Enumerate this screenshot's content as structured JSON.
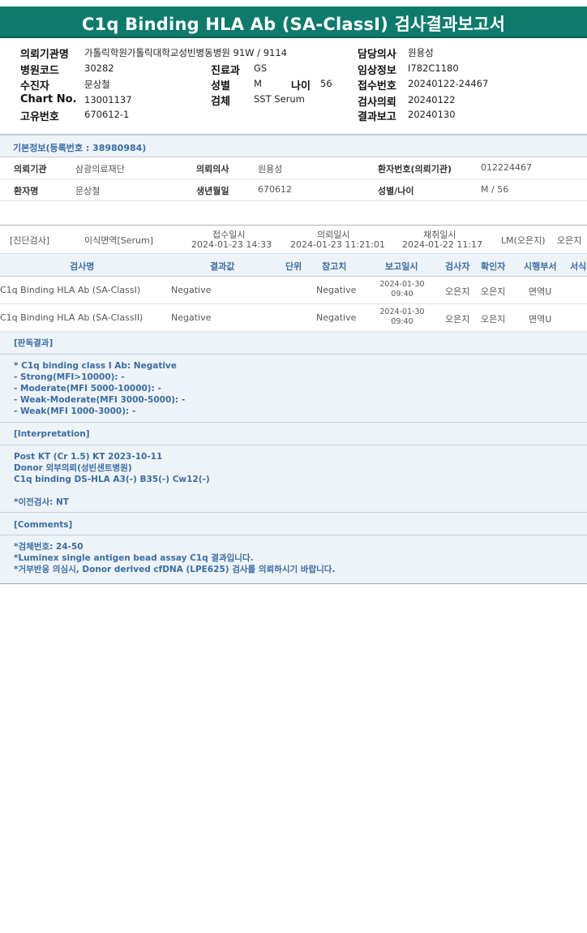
{
  "title": "C1q Binding HLA Ab (SA-ClassI) 검사결과보고서",
  "header": {
    "left": [
      {
        "label": "의뢰기관명",
        "value": "가톨릭학원가톨릭대학교성빈병동병원 91W / 9114"
      },
      {
        "label": "병원코드",
        "value": "30282"
      },
      {
        "label": "수진자",
        "value": "문상철"
      },
      {
        "label": "Chart No.",
        "value": "13001137"
      },
      {
        "label": "고유번호",
        "value": "670612-1"
      }
    ],
    "mid": [
      {
        "label": "진료과",
        "value": "GS"
      },
      {
        "label": "성별",
        "value": "M"
      },
      {
        "label": "검체",
        "value": "SST Serum"
      }
    ],
    "age": {
      "label": "나이",
      "value": "56"
    },
    "right": [
      {
        "label": "담당의사",
        "value": "원용성"
      },
      {
        "label": "임상정보",
        "value": "I782C1180"
      },
      {
        "label": "접수번호",
        "value": "20240122-24467"
      },
      {
        "label": "검사의뢰",
        "value": "20240122"
      },
      {
        "label": "결과보고",
        "value": "20240130"
      }
    ]
  },
  "basic": {
    "title": "기본정보(등록번호 : 38980984)",
    "rows": [
      [
        {
          "label": "의뢰기관",
          "value": "삼광의료재단"
        },
        {
          "label": "의뢰의사",
          "value": "원용성"
        },
        {
          "label": "환자번호(의뢰기관)",
          "value": "012224467"
        }
      ],
      [
        {
          "label": "환자명",
          "value": "문상철"
        },
        {
          "label": "생년월일",
          "value": "670612"
        },
        {
          "label": "성별/나이",
          "value": "M / 56"
        }
      ]
    ]
  },
  "specimen": {
    "category": "[진단검사]",
    "type": "이식면역[Serum]",
    "received_label": "접수일시",
    "received": "2024-01-23 14:33",
    "requested_label": "의뢰일시",
    "requested": "2024-01-23 11:21:01",
    "collected_label": "채취일시",
    "collected": "2024-01-22 11:17",
    "lm": "LM(오은지)",
    "tester": "오은지"
  },
  "table": {
    "headers": [
      "검사명",
      "결과값",
      "단위",
      "참고치",
      "보고일시",
      "검사자",
      "확인자",
      "시행부서",
      "서식"
    ],
    "rows": [
      {
        "name": "C1q Binding HLA Ab (SA-ClassI)",
        "result": "Negative",
        "unit": "",
        "ref": "Negative",
        "date": "2024-01-30",
        "time": "09:40",
        "tester": "오은지",
        "checker": "오은지",
        "dept": "면역U"
      },
      {
        "name": "C1q Binding HLA Ab (SA-ClassII)",
        "result": "Negative",
        "unit": "",
        "ref": "Negative",
        "date": "2024-01-30",
        "time": "09:40",
        "tester": "오은지",
        "checker": "오은지",
        "dept": "면역U"
      }
    ]
  },
  "judgement": {
    "title": "[판독결과]",
    "lines": [
      "* C1q binding class I Ab: Negative",
      "- Strong(MFI>10000): -",
      "- Moderate(MFI 5000-10000): -",
      "- Weak-Moderate(MFI 3000-5000): -",
      "- Weak(MFI 1000-3000): -"
    ]
  },
  "interpretation": {
    "title": "[Interpretation]",
    "lines": [
      "Post KT (Cr 1.5) KT 2023-10-11",
      "Donor 외부의뢰(성빈센트병원)",
      "C1q binding DS-HLA A3(-) B35(-) Cw12(-)",
      "",
      "*이전검사: NT"
    ]
  },
  "comments": {
    "title": "[Comments]",
    "lines": [
      "*검체번호: 24-50",
      "*Luminex single antigen bead assay C1q 결과입니다.",
      "*거부반응 의심시, Donor derived cfDNA (LPE625) 검사를 의뢰하시기 바랍니다."
    ]
  }
}
